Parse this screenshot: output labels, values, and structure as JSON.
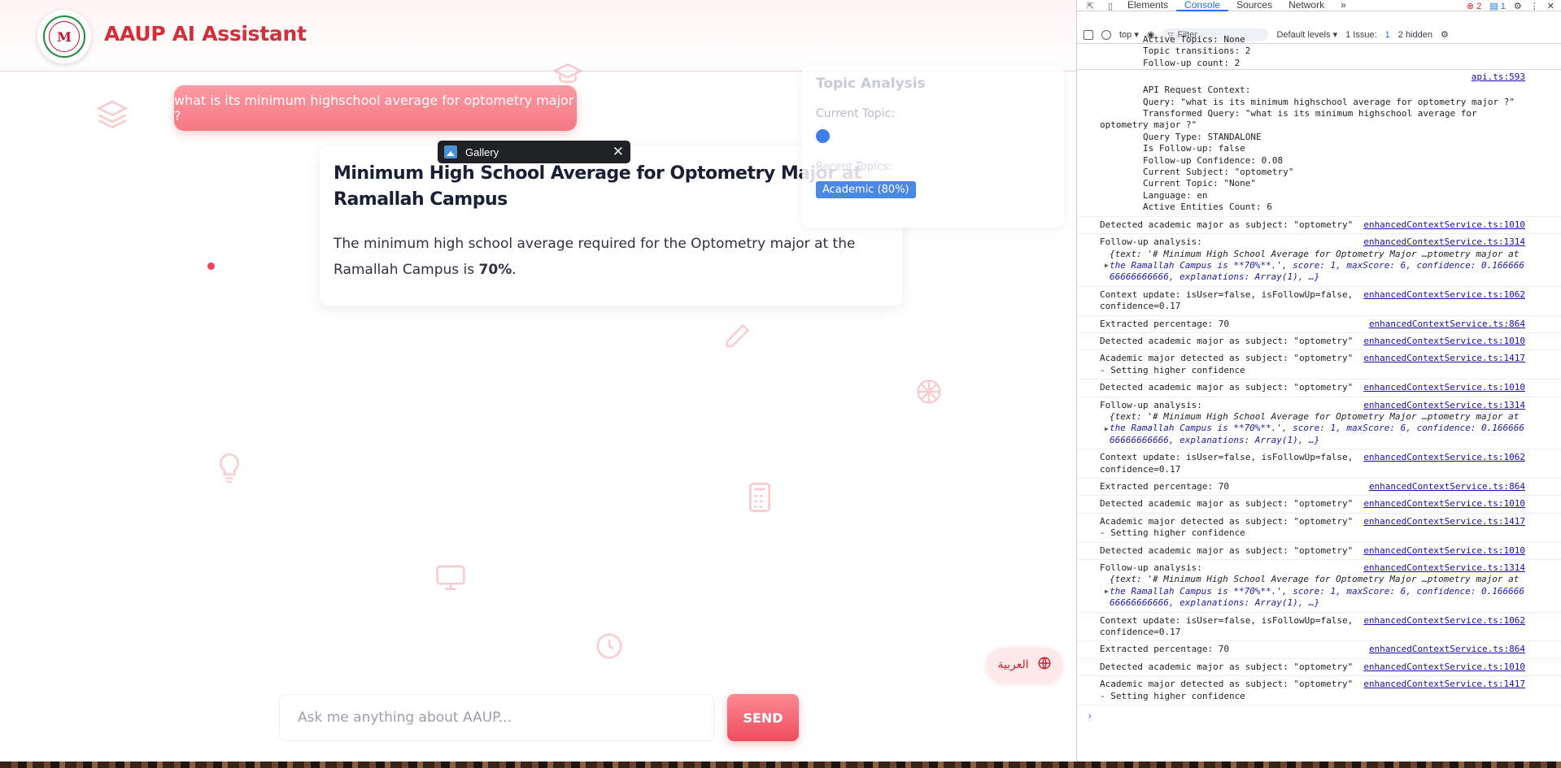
{
  "app": {
    "title": "AAUP AI Assistant",
    "logo_text": "M"
  },
  "chat": {
    "user_message": "what is its minimum highschool average for optometry major ?",
    "answer_title": "Minimum High School Average for Optometry Major at Ramallah Campus",
    "answer_body_prefix": "The minimum high school average required for the Optometry major at the Ramallah Campus is ",
    "answer_body_value": "70%",
    "answer_body_suffix": ".",
    "input_placeholder": "Ask me anything about AAUP...",
    "send_label": "SEND",
    "language_label": "العربية"
  },
  "topic_panel": {
    "title": "Topic Analysis",
    "current_topic_label": "Current Topic:",
    "ghost_label": "Recent Topics:",
    "badge": "Academic (80%)"
  },
  "gallery_bar": {
    "label": "Gallery",
    "close": "✕"
  },
  "devtools": {
    "tabs": [
      "Elements",
      "Console",
      "Sources",
      "Network"
    ],
    "active_tab": "Console",
    "more": "»",
    "error_count": "2",
    "message_count": "1",
    "context": "top ▾",
    "filter_placeholder": "Filter",
    "levels": "Default levels ▾",
    "issues": "1 Issue:",
    "issues_count": "1",
    "hidden": "2 hidden",
    "prompt": "›",
    "header_block": [
      "        Active Topics: None",
      "        Topic transitions: 2",
      "        Follow-up count: 2"
    ],
    "api_source": "api.ts:593",
    "api_block": [
      "        API Request Context:",
      "        Query: \"what is its minimum highschool average for optometry major ?\"",
      "        Transformed Query: \"what is its minimum highschool average for",
      "optometry major ?\"",
      "        Query Type: STANDALONE",
      "        Is Follow-up: false",
      "        Follow-up Confidence: 0.08",
      "        Current Subject: \"optometry\"",
      "        Current Topic: \"None\"",
      "        Language: en",
      "        Active Entities Count: 6"
    ],
    "entries": [
      {
        "text": "Detected academic major as subject: \"optometry\"",
        "src": "enhancedContextService.ts:1010"
      },
      {
        "text": "Follow-up analysis:",
        "src": "enhancedContextService.ts:1314",
        "obj": [
          "{text: '# Minimum High School Average for Optometry Major …ptometry major at",
          "the Ramallah Campus is **70%**.', score: 1, maxScore: 6, confidence: 0.166666",
          "66666666666, explanations: Array(1), …}"
        ]
      },
      {
        "text": "Context update: isUser=false, isFollowUp=false,\nconfidence=0.17",
        "src": "enhancedContextService.ts:1062"
      },
      {
        "text": "Extracted percentage: 70",
        "src": "enhancedContextService.ts:864"
      },
      {
        "text": "Detected academic major as subject: \"optometry\"",
        "src": "enhancedContextService.ts:1010"
      },
      {
        "text": "Academic major detected as subject: \"optometry\"\n- Setting higher confidence",
        "src": "enhancedContextService.ts:1417"
      },
      {
        "text": "Detected academic major as subject: \"optometry\"",
        "src": "enhancedContextService.ts:1010"
      },
      {
        "text": "Follow-up analysis:",
        "src": "enhancedContextService.ts:1314",
        "obj": [
          "{text: '# Minimum High School Average for Optometry Major …ptometry major at",
          "the Ramallah Campus is **70%**.', score: 1, maxScore: 6, confidence: 0.166666",
          "66666666666, explanations: Array(1), …}"
        ]
      },
      {
        "text": "Context update: isUser=false, isFollowUp=false,\nconfidence=0.17",
        "src": "enhancedContextService.ts:1062"
      },
      {
        "text": "Extracted percentage: 70",
        "src": "enhancedContextService.ts:864"
      },
      {
        "text": "Detected academic major as subject: \"optometry\"",
        "src": "enhancedContextService.ts:1010"
      },
      {
        "text": "Academic major detected as subject: \"optometry\"\n- Setting higher confidence",
        "src": "enhancedContextService.ts:1417"
      },
      {
        "text": "Detected academic major as subject: \"optometry\"",
        "src": "enhancedContextService.ts:1010"
      },
      {
        "text": "Follow-up analysis:",
        "src": "enhancedContextService.ts:1314",
        "obj": [
          "{text: '# Minimum High School Average for Optometry Major …ptometry major at",
          "the Ramallah Campus is **70%**.', score: 1, maxScore: 6, confidence: 0.166666",
          "66666666666, explanations: Array(1), …}"
        ]
      },
      {
        "text": "Context update: isUser=false, isFollowUp=false,\nconfidence=0.17",
        "src": "enhancedContextService.ts:1062"
      },
      {
        "text": "Extracted percentage: 70",
        "src": "enhancedContextService.ts:864"
      },
      {
        "text": "Detected academic major as subject: \"optometry\"",
        "src": "enhancedContextService.ts:1010"
      },
      {
        "text": "Academic major detected as subject: \"optometry\"\n- Setting higher confidence",
        "src": "enhancedContextService.ts:1417"
      }
    ]
  },
  "colors": {
    "brand_red": "#d22f3b",
    "user_bubble": "#f57883",
    "topic_badge": "#4b88e6",
    "devtools_accent": "#1a73e8"
  },
  "icons": [
    "book-stack-icon",
    "graduation-cap-icon",
    "pencil-icon",
    "basketball-icon",
    "lightbulb-icon",
    "calculator-icon",
    "monitor-icon",
    "clock-icon",
    "globe-icon",
    "gallery-icon",
    "close-icon"
  ]
}
